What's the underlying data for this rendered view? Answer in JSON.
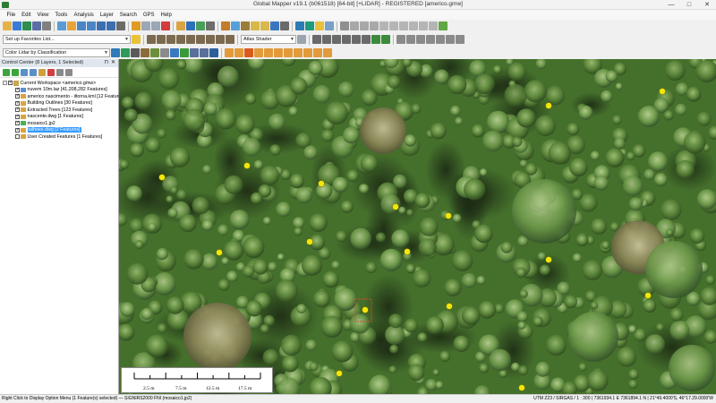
{
  "window": {
    "title": "Global Mapper v19.1 (b061518) [64-bit] [+LIDAR] - REGISTERED [americo.gmw]",
    "minimize": "—",
    "maximize": "□",
    "close": "✕"
  },
  "menu": [
    "File",
    "Edit",
    "View",
    "Tools",
    "Analysis",
    "Layer",
    "Search",
    "GPS",
    "Help"
  ],
  "toolbar": {
    "favorites": "Set up Favorites List...",
    "shader": "Atlas Shader",
    "lidar_color": "Color Lidar by Classification"
  },
  "control_center": {
    "header": "Control Center (8 Layers, 1 Selected)",
    "pin": "⊓",
    "close": "✕",
    "workspace": "Current Workspace <americo.gmw>",
    "layers": [
      {
        "label": "nuvem 10m.laz [41,208,282 Features]",
        "checked": true,
        "selected": false,
        "color": "#5b8fd6"
      },
      {
        "label": "americo nascimento - iltorna.kml [12 Features]",
        "checked": true,
        "selected": false,
        "color": "#d9a441"
      },
      {
        "label": "Building Outlines [30 Features]",
        "checked": true,
        "selected": false,
        "color": "#d9a441"
      },
      {
        "label": "Extracted Trees [123 Features]",
        "checked": true,
        "selected": false,
        "color": "#d9a441"
      },
      {
        "label": "nascente.dwg [1 Features]",
        "checked": true,
        "selected": false,
        "color": "#d9a441"
      },
      {
        "label": "mosaico1.jp2",
        "checked": true,
        "selected": false,
        "color": "#4caf50"
      },
      {
        "label": "talhoes.dwg [2 Features]",
        "checked": true,
        "selected": true,
        "color": "#d9a441"
      },
      {
        "label": "User Created Features [1 Features]",
        "checked": false,
        "selected": false,
        "color": "#d9a441"
      }
    ]
  },
  "scale_bar": {
    "labels": [
      "2.5 m",
      "7.5 m",
      "12.5 m",
      "17.5 m"
    ]
  },
  "status": {
    "left": "Right Click to Display Option Menu (1 Feature(s) selected) — SIGNIRS2000 FNI (mosaico1.jp2)",
    "right": "UTM Z23 / SIRGAS / 1 : 300 | 7361934.1 E 7361894.1 N | 21°49.4000'S, 46°17.29.0000'W"
  },
  "colors": {
    "canopy_dark": "#2f4f1f",
    "canopy_mid": "#4f7c33",
    "canopy_light": "#8fb06a",
    "tree_point": "#f3e60a",
    "selection": "#3399ff",
    "feature_outline": "#d14b2c"
  }
}
